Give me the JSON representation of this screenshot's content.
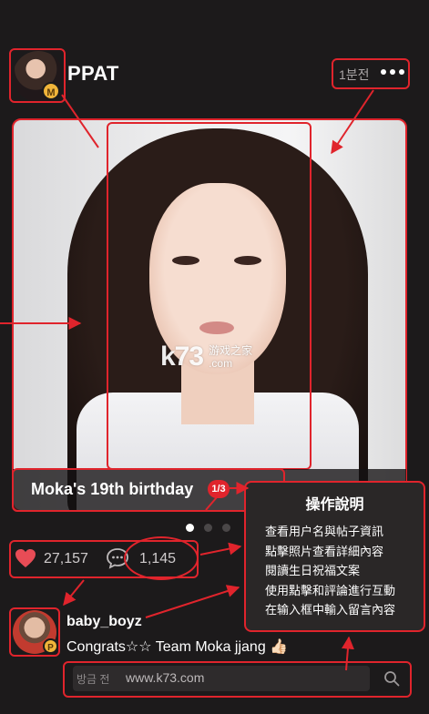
{
  "header": {
    "username": "PPAT",
    "avatar_badge": "M",
    "time_ago": "1분전",
    "more_icon": "more-horizontal-icon"
  },
  "post": {
    "caption": "Moka's 19th birthday",
    "page_indicator": "1/3",
    "watermark_logo": "k73",
    "watermark_text_1": "游戏之家",
    "watermark_text_2": ".com",
    "carousel": {
      "total": 3,
      "active": 1
    }
  },
  "stats": {
    "likes": "27,157",
    "comments": "1,145",
    "like_icon": "heart-icon",
    "comment_icon": "comment-bubble-icon"
  },
  "help": {
    "title": "操作說明",
    "items": [
      "查看用户名與帖子資訊",
      "點擊照片查看詳細內容",
      "閱讀生日祝福文案",
      "使用點擊和評論進行互動",
      "在输入框中輸入留言內容"
    ]
  },
  "comment": {
    "username": "baby_boyz",
    "badge": "P",
    "text": "Congrats☆☆ Team Moka jjang 👍🏻"
  },
  "input": {
    "label": "방금 전",
    "url": "www.k73.com",
    "search_icon": "search-icon"
  },
  "colors": {
    "background": "#1c1a1b",
    "annotation_red": "#e0242c",
    "heart": "#e84c56",
    "badge_gold": "#f0b43a"
  }
}
